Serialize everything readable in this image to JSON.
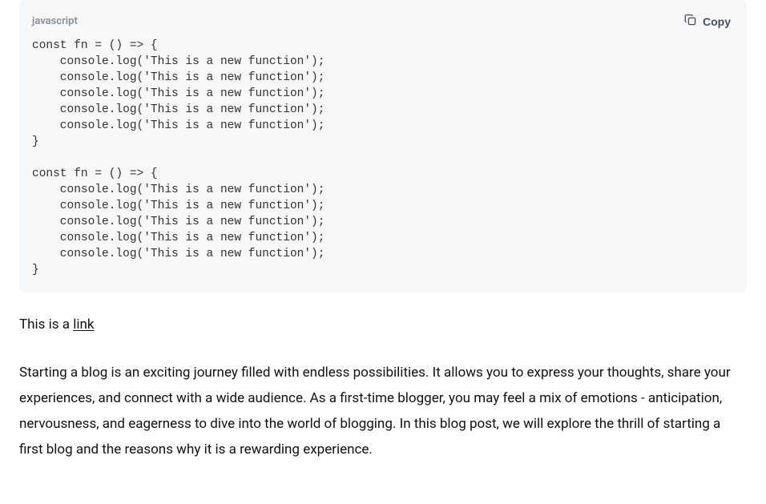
{
  "codeblock": {
    "language": "javascript",
    "copy_label": "Copy",
    "code": "const fn = () => {\n    console.log('This is a new function');\n    console.log('This is a new function');\n    console.log('This is a new function');\n    console.log('This is a new function');\n    console.log('This is a new function');\n}\n\nconst fn = () => {\n    console.log('This is a new function');\n    console.log('This is a new function');\n    console.log('This is a new function');\n    console.log('This is a new function');\n    console.log('This is a new function');\n}"
  },
  "link_paragraph": {
    "prefix": "This is a ",
    "link_text": "link"
  },
  "body_paragraph": "Starting a blog is an exciting journey filled with endless possibilities. It allows you to express your thoughts, share your experiences, and connect with a wide audience. As a first-time blogger, you may feel a mix of emotions - anticipation, nervousness, and eagerness to dive into the world of blogging. In this blog post, we will explore the thrill of starting a first blog and the reasons why it is a rewarding experience."
}
